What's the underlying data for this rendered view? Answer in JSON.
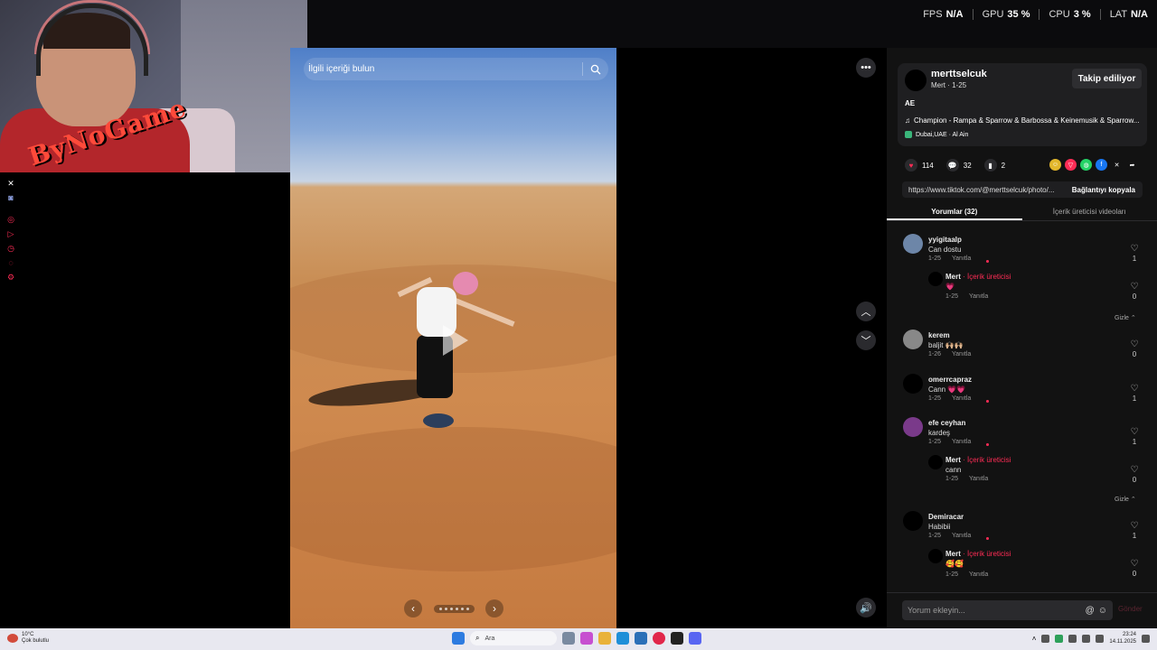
{
  "perf": {
    "items": [
      {
        "label": "FPS",
        "value": "N/A"
      },
      {
        "label": "GPU",
        "value": "35 %"
      },
      {
        "label": "CPU",
        "value": "3 %"
      },
      {
        "label": "LAT",
        "value": "N/A"
      }
    ]
  },
  "overlay": {
    "logo_text": "ByNoGame"
  },
  "search": {
    "placeholder": "İlgili içeriği bulun"
  },
  "author": {
    "username": "merttselcuk",
    "subtitle": "Mert · 1-25",
    "follow_label": "Takip ediliyor",
    "caption": "AE",
    "music": "Champion - Rampa & Sparrow & Barbossa & Keinemusik & Sparrow...",
    "location": "Dubai,UAE · Al Ain"
  },
  "stats": {
    "likes": "114",
    "comments": "32",
    "saves": "2"
  },
  "link": {
    "url": "https://www.tiktok.com/@merttselcuk/photo/...",
    "copy_label": "Bağlantıyı kopyala"
  },
  "tabs": [
    {
      "label": "Yorumlar (32)"
    },
    {
      "label": "İçerik üreticisi videoları"
    }
  ],
  "comments": [
    {
      "name": "yyigitaalp",
      "text": "Can dostu",
      "date": "1-25",
      "reply": "Yanıtla",
      "likes": "1"
    },
    {
      "name": "Mert",
      "tag": " · İçerik üreticisi",
      "text": "💗",
      "date": "1-25",
      "reply": "Yanıtla",
      "likes": "0"
    },
    {
      "name": "kerem",
      "text": "baljit 🙌🏼🙌🏼",
      "date": "1-26",
      "reply": "Yanıtla",
      "likes": "0"
    },
    {
      "name": "omerrcapraz",
      "text": "Cann 💗💗",
      "date": "1-25",
      "reply": "Yanıtla",
      "likes": "1"
    },
    {
      "name": "efe ceyhan",
      "text": "kardeş",
      "date": "1-25",
      "reply": "Yanıtla",
      "likes": "1"
    },
    {
      "name": "Mert",
      "tag": " · İçerik üreticisi",
      "text": "cann",
      "date": "1-25",
      "reply": "Yanıtla",
      "likes": "0"
    },
    {
      "name": "Demiracar",
      "text": "Habibii",
      "date": "1-25",
      "reply": "Yanıtla",
      "likes": "1"
    },
    {
      "name": "Mert",
      "tag": " · İçerik üreticisi",
      "text": "🥰🥰",
      "date": "1-25",
      "reply": "Yanıtla",
      "likes": "0"
    }
  ],
  "hide_label": "Gizle ⌃",
  "comment_input": {
    "placeholder": "Yorum ekleyin...",
    "send_label": "Gönder"
  },
  "taskbar": {
    "weather_temp": "10°C",
    "weather_desc": "Çok bulutlu",
    "search_text": "Ara",
    "time": "23:24",
    "date": "14.11.2025"
  },
  "colors": {
    "accent": "#fe2c55",
    "panel_bg": "#121212"
  }
}
